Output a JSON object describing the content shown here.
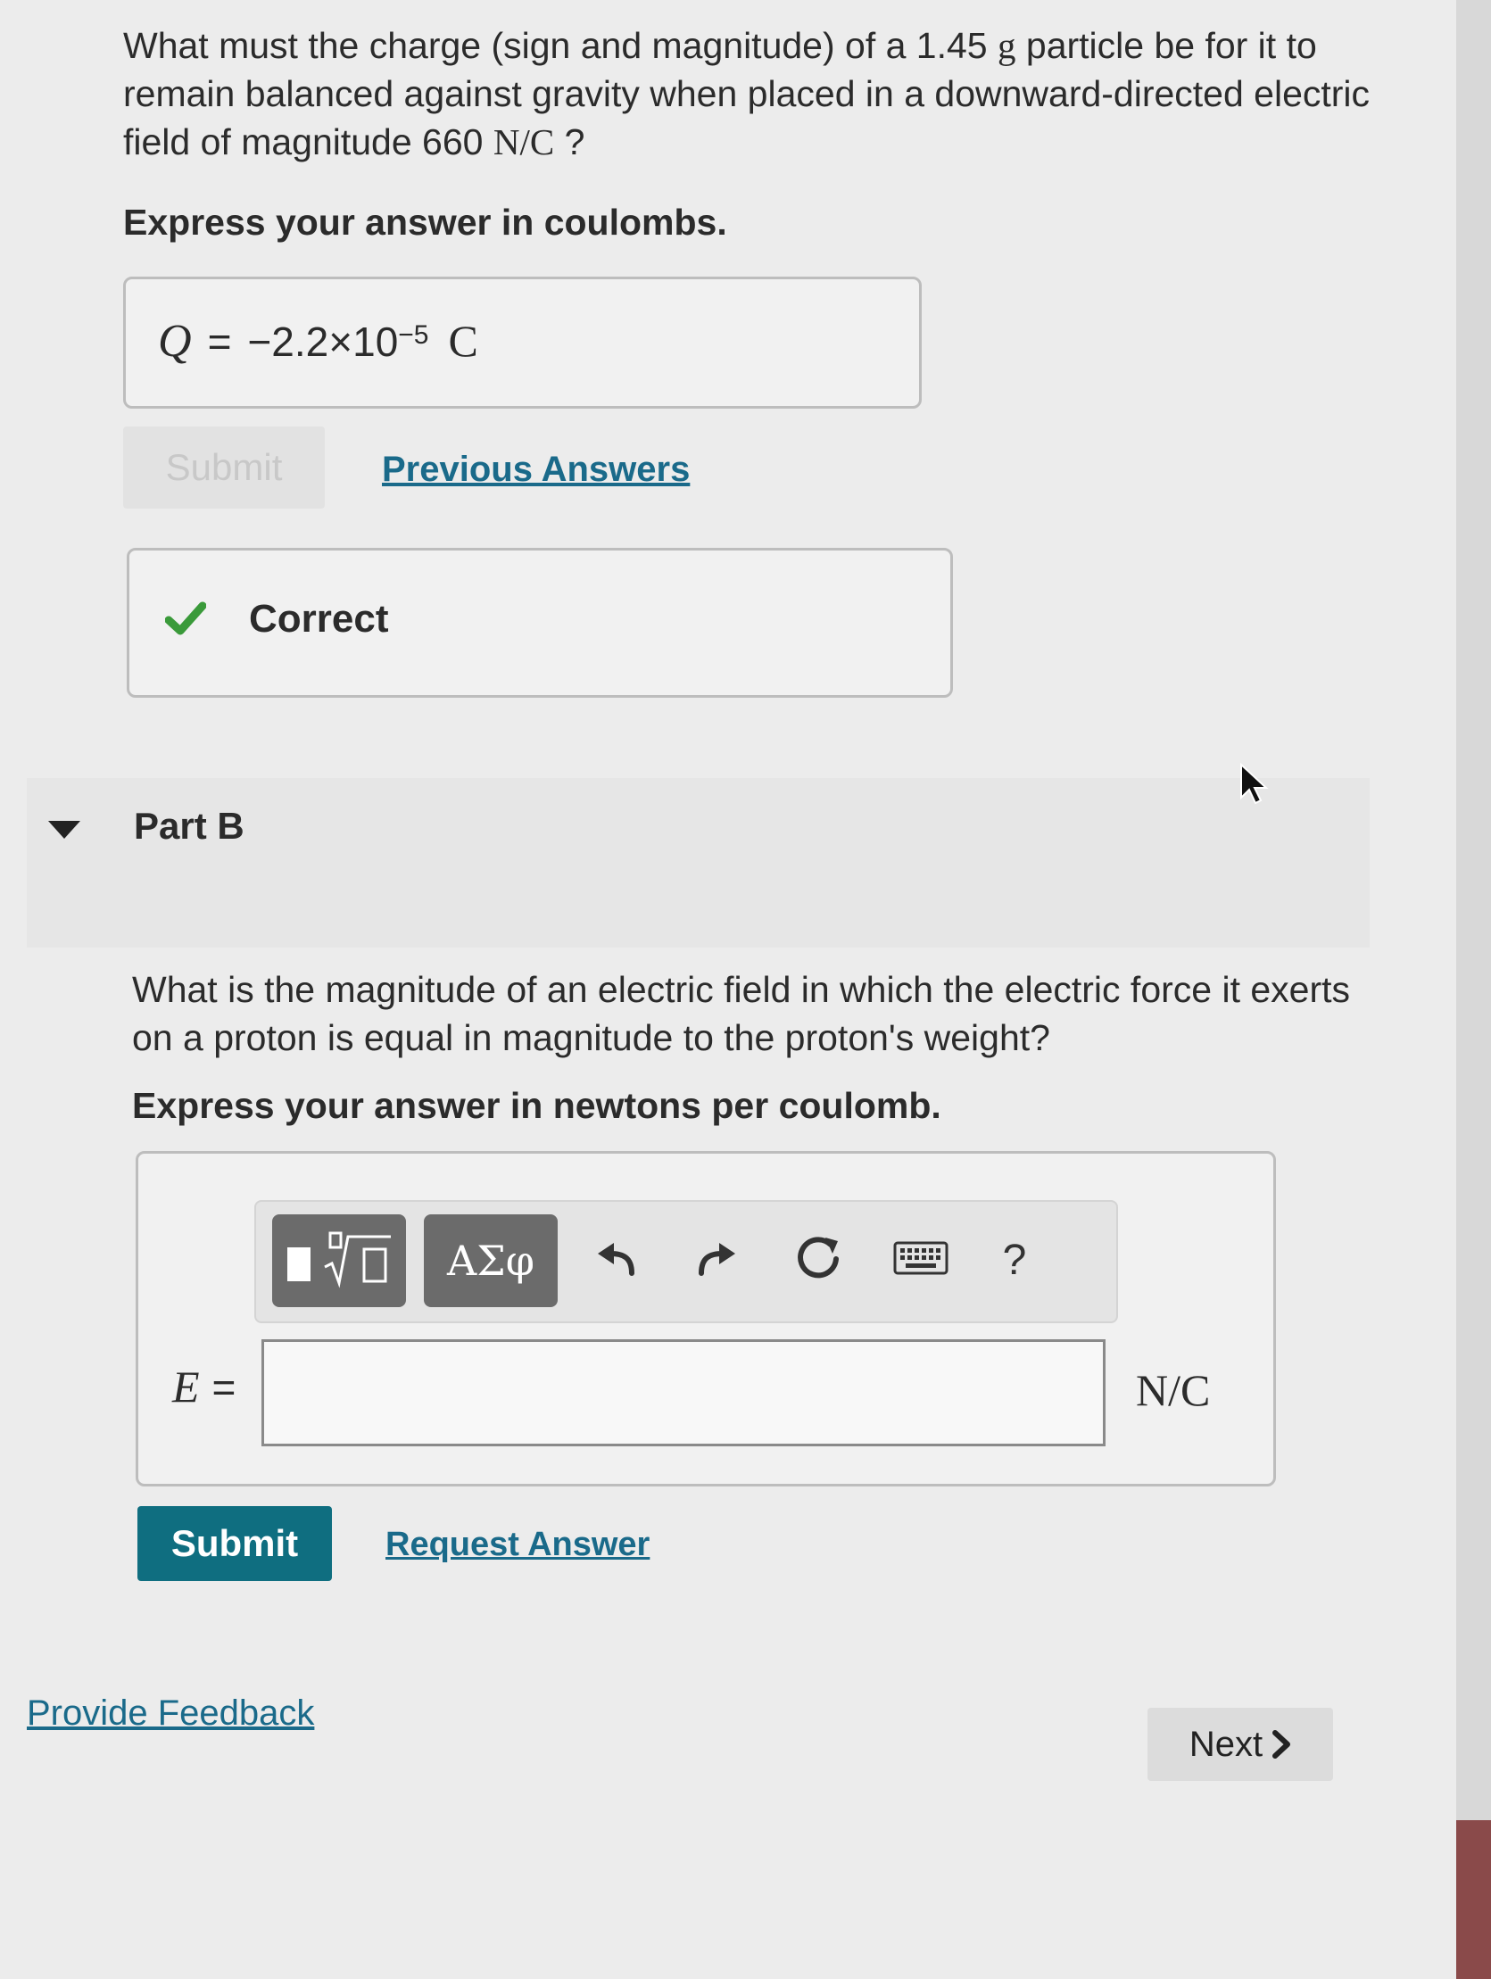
{
  "partA": {
    "question_pre": "What must the charge (sign and magnitude) of a 1.45 ",
    "question_unit_g": "g",
    "question_mid": " particle be for it to remain balanced against gravity when placed in a downward-directed electric field of magnitude 660 ",
    "question_unit_nc": "N/C",
    "question_post": " ?",
    "instruction": "Express your answer in coulombs.",
    "answer_var": "Q",
    "answer_eq": "=",
    "answer_mantissa": "−2.2×10",
    "answer_exp": "−5",
    "answer_unit": "C",
    "submit_label": "Submit",
    "previous_answers_label": "Previous Answers",
    "feedback_label": "Correct"
  },
  "partB": {
    "title": "Part B",
    "question": "What is the magnitude of an electric field in which the electric force it exerts on a proton is equal in magnitude to the proton's weight?",
    "instruction": "Express your answer in newtons per coulomb.",
    "toolbar": {
      "greek_label": "ΑΣφ",
      "help_label": "?"
    },
    "answer_var": "E",
    "answer_eq": "=",
    "answer_value": "",
    "answer_unit": "N/C",
    "submit_label": "Submit",
    "request_answer_label": "Request Answer"
  },
  "footer": {
    "feedback_label": "Provide Feedback",
    "next_label": "Next"
  },
  "colors": {
    "submit_bg": "#0f6e80",
    "link": "#1a6a8a",
    "check": "#3a9a3a"
  }
}
